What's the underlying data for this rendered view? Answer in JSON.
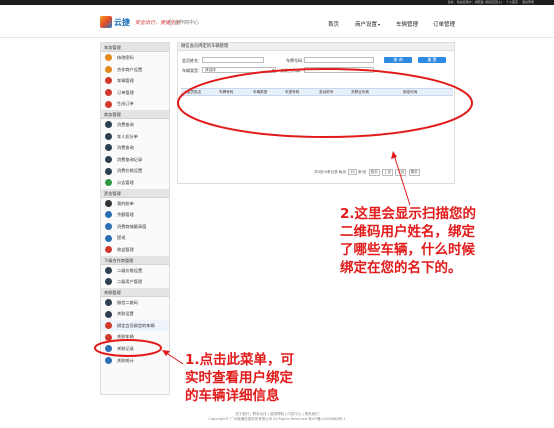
{
  "topbar": {
    "links": [
      "您好，欢迎您用户：谢晓鑫 [测试空置人]",
      "个人首页",
      "退出登录"
    ]
  },
  "header": {
    "logo_text": "云捷",
    "slogan": "安全出行，便捷生活",
    "center_title": "合作商中心",
    "nav": [
      "首页",
      "商户设置",
      "车辆管理",
      "订单管理"
    ],
    "nav_dropdown_indicator": "▾"
  },
  "sidebar": {
    "sections": [
      {
        "title": "车务管理",
        "items": [
          {
            "label": "修改密码",
            "icon": "pencil-icon",
            "color": "#e28a1c"
          },
          {
            "label": "合作商户设置",
            "icon": "settings-icon",
            "color": "#e28a1c"
          },
          {
            "label": "车辆管理",
            "icon": "car-icon",
            "color": "#d0392b"
          },
          {
            "label": "订单管理",
            "icon": "order-icon",
            "color": "#d0392b"
          },
          {
            "label": "生成订单",
            "icon": "order-add-icon",
            "color": "#d0392b"
          }
        ]
      },
      {
        "title": "商务管理",
        "items": [
          {
            "label": "消费查询",
            "icon": "search-icon",
            "color": "#2c3e50"
          },
          {
            "label": "车人扣分单",
            "icon": "user-icon",
            "color": "#2c3e50"
          },
          {
            "label": "消费查询",
            "icon": "search-icon",
            "color": "#2c3e50"
          },
          {
            "label": "消费查询记录",
            "icon": "record-icon",
            "color": "#2c3e50"
          },
          {
            "label": "消费价格设置",
            "icon": "price-icon",
            "color": "#2c3e50"
          },
          {
            "label": "公告管理",
            "icon": "notice-icon",
            "color": "#2e9a46"
          }
        ]
      },
      {
        "title": "资金管理",
        "items": [
          {
            "label": "我的账单",
            "icon": "wallet-icon",
            "color": "#333333"
          },
          {
            "label": "余额管理",
            "icon": "balance-icon",
            "color": "#2c6fb5"
          },
          {
            "label": "消费商城最高值",
            "icon": "mall-icon",
            "color": "#2c6fb5"
          },
          {
            "label": "提现",
            "icon": "withdraw-icon",
            "color": "#2c6fb5"
          },
          {
            "label": "收益管理",
            "icon": "income-icon",
            "color": "#d0392b"
          }
        ]
      },
      {
        "title": "下级合作商管理",
        "items": [
          {
            "label": "二级价格设置",
            "icon": "level-price-icon",
            "color": "#2c3e50"
          },
          {
            "label": "二级用户管理",
            "icon": "user-icon",
            "color": "#2c3e50"
          }
        ]
      },
      {
        "title": "关联管理",
        "items": [
          {
            "label": "微信二维码",
            "icon": "qrcode-icon",
            "color": "#2c3e50"
          },
          {
            "label": "关联设置",
            "icon": "link-icon",
            "color": "#2c3e50"
          },
          {
            "label": "绑定会员绑定的车辆",
            "icon": "bind-car-icon",
            "color": "#d0392b",
            "active": true
          },
          {
            "label": "关联车辆",
            "icon": "car-link-icon",
            "color": "#d0392b"
          },
          {
            "label": "关联记录",
            "icon": "link-record-icon",
            "color": "#2c6fb5"
          },
          {
            "label": "关联统计",
            "icon": "stats-icon",
            "color": "#2c6fb5"
          }
        ]
      }
    ]
  },
  "content": {
    "title": "微信会员绑定的车辆管理",
    "filters": {
      "member_name_label": "会员姓名：",
      "plate_label": "车牌号码：",
      "type_label": "车辆类型：",
      "type_value": "请选择",
      "bind_time_label": "关联合作商：",
      "query_button": "查 询",
      "reset_button": "重 置"
    },
    "table_headers": [
      "会员姓名",
      "车牌号码",
      "车辆类型",
      "车型号码",
      "发动机号",
      "关联合作商",
      "绑定时间"
    ],
    "pager": {
      "summary": "共0页/0条记录 每页",
      "per_page": "10",
      "goto": "条/页",
      "buttons": [
        "首页",
        "上页",
        "下页",
        "尾页"
      ]
    }
  },
  "annotations": {
    "right": [
      "2.这里会显示扫描您的",
      "二维码用户姓名，绑定",
      "了哪些车辆，什么时候",
      "绑定在您的名下的。"
    ],
    "left": [
      "1.点击此菜单，可",
      "实时查看用户绑定",
      "的车辆详细信息"
    ],
    "color": "#e31a1a"
  },
  "footer": {
    "links": [
      "关于我们",
      "联系合作",
      "使用帮助",
      "问答中心",
      "联系我们"
    ],
    "copyright": "Copyright© 广州城通信息科技有限公司 All Rights Reserved 粤ICP备12009888号-1"
  }
}
